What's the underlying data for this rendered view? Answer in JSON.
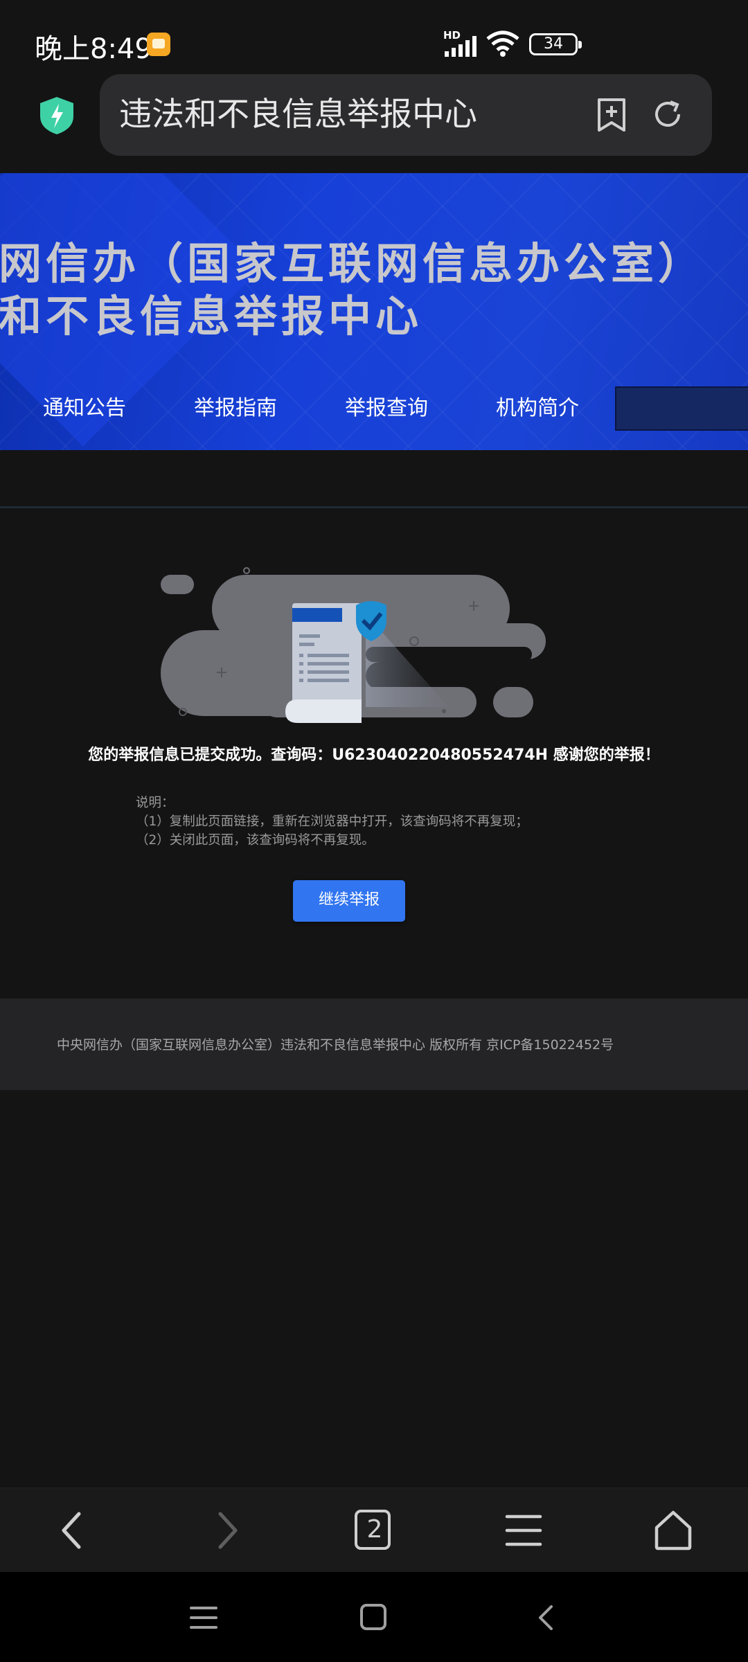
{
  "status_bar": {
    "time": "晚上8:49",
    "network": "HD",
    "battery": "34"
  },
  "browser": {
    "url_title": "违法和不良信息举报中心",
    "tab_count": "2"
  },
  "banner": {
    "line1": "网信办（国家互联网信息办公室）",
    "line2": "和不良信息举报中心",
    "nav_items": [
      "通知公告",
      "举报指南",
      "举报查询",
      "机构简介"
    ]
  },
  "main": {
    "success_message": "您的举报信息已提交成功。查询码：U623040220480552474H 感谢您的举报！",
    "notes_title": "说明：",
    "note1": "（1）复制此页面链接，重新在浏览器中打开，该查询码将不再复现；",
    "note2": "（2）关闭此页面，该查询码将不再复现。",
    "continue_button": "继续举报"
  },
  "footer": {
    "text": "中央网信办（国家互联网信息办公室）违法和不良信息举报中心 版权所有 京ICP备15022452号"
  },
  "colors": {
    "accent": "#3175f0",
    "banner": "#1a44d6",
    "background": "#141414"
  },
  "icons": [
    "shield-icon",
    "bookmark-add-icon",
    "refresh-icon",
    "back-icon",
    "forward-icon",
    "tabs-icon",
    "menu-icon",
    "home-icon"
  ]
}
